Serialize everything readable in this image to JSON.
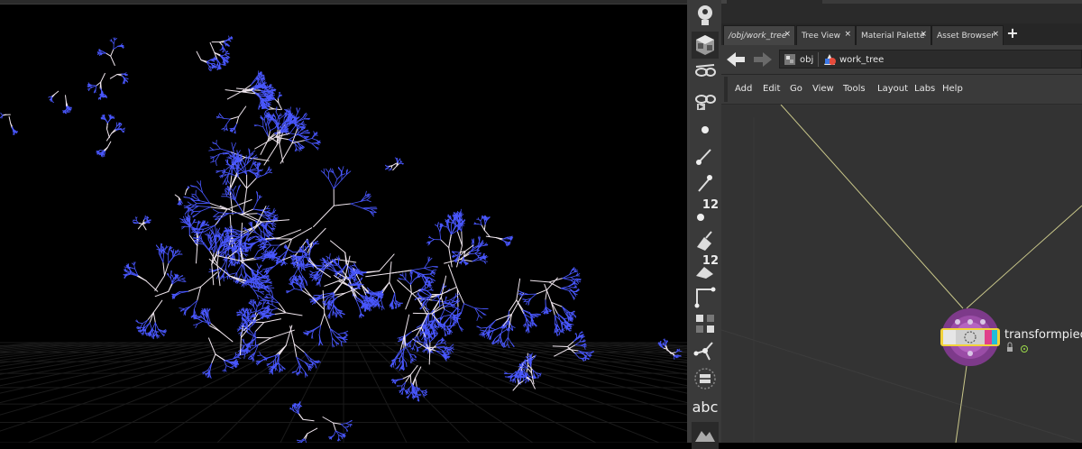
{
  "tabs": [
    {
      "label": "/obj/work_tree",
      "close": "×",
      "active": true
    },
    {
      "label": "Tree View",
      "close": "×",
      "active": false
    },
    {
      "label": "Material Palette",
      "close": "×",
      "active": false
    },
    {
      "label": "Asset Browser",
      "close": "×",
      "active": false
    }
  ],
  "new_tab": "+",
  "path": {
    "root": "obj",
    "current": "work_tree"
  },
  "menus": [
    "Add",
    "Edit",
    "Go",
    "View",
    "Tools",
    "Layout",
    "Labs",
    "Help"
  ],
  "shelf": {
    "count_badge_1": "12",
    "count_badge_2": "12",
    "text_tool": "abc"
  },
  "node": {
    "label": "transformpiec"
  },
  "colors": {
    "branch_blue": "#4a58ff",
    "node_outer": "#7d3a8a",
    "node_select": "#f2d23a",
    "node_cyan": "#22bcd8",
    "node_pink": "#e0408a",
    "wire": "#c9c78a"
  }
}
